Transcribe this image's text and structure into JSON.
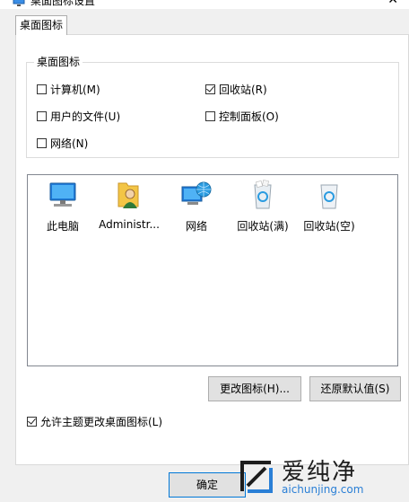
{
  "window": {
    "title": "桌面图标设置",
    "close_glyph": "✕"
  },
  "tabs": [
    {
      "label": "桌面图标"
    }
  ],
  "group": {
    "legend": "桌面图标",
    "checkboxes": [
      {
        "label": "计算机(M)",
        "checked": false
      },
      {
        "label": "回收站(R)",
        "checked": true
      },
      {
        "label": "用户的文件(U)",
        "checked": false
      },
      {
        "label": "控制面板(O)",
        "checked": false
      },
      {
        "label": "网络(N)",
        "checked": false
      }
    ]
  },
  "icons": [
    {
      "label": "此电脑",
      "icon": "computer-icon"
    },
    {
      "label": "Administr...",
      "icon": "user-folder-icon"
    },
    {
      "label": "网络",
      "icon": "network-icon"
    },
    {
      "label": "回收站(满)",
      "icon": "recycle-bin-full-icon"
    },
    {
      "label": "回收站(空)",
      "icon": "recycle-bin-empty-icon"
    }
  ],
  "buttons": {
    "change_icon": "更改图标(H)...",
    "restore_default": "还原默认值(S)",
    "ok": "确定"
  },
  "allow_theme": {
    "label": "允许主题更改桌面图标(L)",
    "checked": true
  },
  "watermark": {
    "main": "爱纯净",
    "url": "aichunjing.com"
  },
  "colors": {
    "accent": "#0078d7",
    "watermark_blue": "#2a7fd6"
  }
}
